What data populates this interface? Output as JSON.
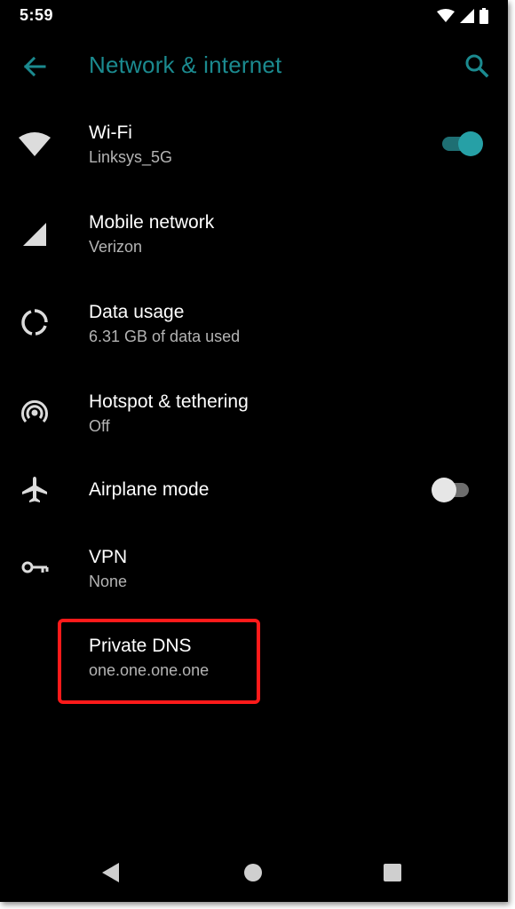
{
  "status_bar": {
    "time": "5:59",
    "icons": [
      "wifi-icon",
      "cell-signal-icon",
      "battery-icon"
    ]
  },
  "app_bar": {
    "title": "Network & internet",
    "accent_color": "#1b8a8f",
    "back_icon": "arrow-back-icon",
    "search_icon": "search-icon"
  },
  "settings": [
    {
      "id": "wifi",
      "title": "Wi-Fi",
      "subtitle": "Linksys_5G",
      "icon": "wifi-icon",
      "toggle": "on"
    },
    {
      "id": "mobile-network",
      "title": "Mobile network",
      "subtitle": "Verizon",
      "icon": "cell-signal-icon"
    },
    {
      "id": "data-usage",
      "title": "Data usage",
      "subtitle": "6.31 GB of data used",
      "icon": "data-usage-icon"
    },
    {
      "id": "hotspot",
      "title": "Hotspot & tethering",
      "subtitle": "Off",
      "icon": "hotspot-icon"
    },
    {
      "id": "airplane-mode",
      "title": "Airplane mode",
      "icon": "airplane-icon",
      "toggle": "off"
    },
    {
      "id": "vpn",
      "title": "VPN",
      "subtitle": "None",
      "icon": "vpn-key-icon"
    },
    {
      "id": "private-dns",
      "title": "Private DNS",
      "subtitle": "one.one.one.one",
      "highlighted": true
    }
  ],
  "highlight_color": "#ff1a1a",
  "nav_bar": {
    "buttons": [
      "back-triangle-icon",
      "home-circle-icon",
      "recents-square-icon"
    ]
  }
}
